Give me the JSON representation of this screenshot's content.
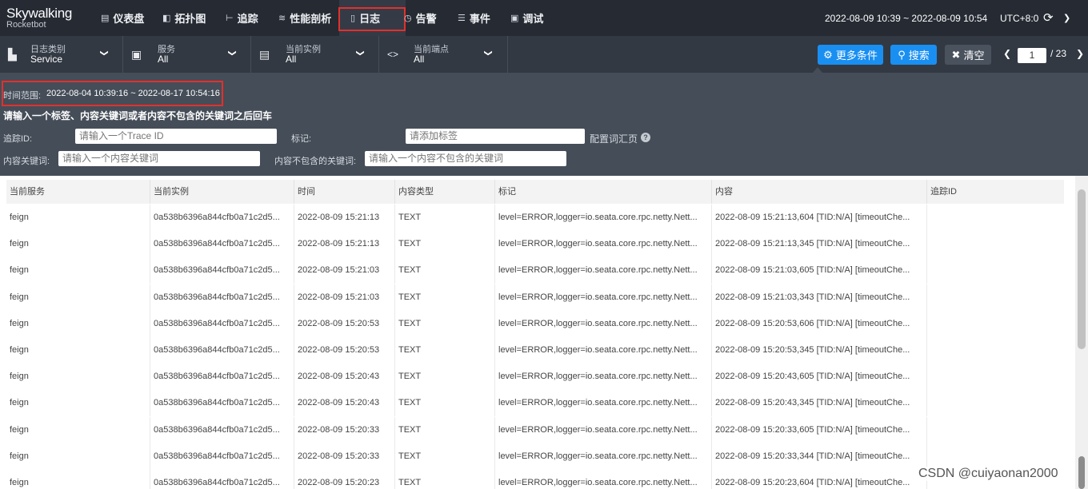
{
  "brand": {
    "name": "Skywalking",
    "sub": "Rocketbot"
  },
  "nav": [
    {
      "label": "仪表盘",
      "icon": "dashboard-icon"
    },
    {
      "label": "拓扑图",
      "icon": "topology-icon"
    },
    {
      "label": "追踪",
      "icon": "trace-icon"
    },
    {
      "label": "性能剖析",
      "icon": "profile-icon"
    },
    {
      "label": "日志",
      "icon": "log-icon"
    },
    {
      "label": "告警",
      "icon": "alarm-icon"
    },
    {
      "label": "事件",
      "icon": "event-icon"
    },
    {
      "label": "调试",
      "icon": "debug-icon"
    }
  ],
  "header": {
    "time_range": "2022-08-09 10:39 ~ 2022-08-09 10:54",
    "timezone": "UTC+8:0"
  },
  "filters": [
    {
      "label": "日志类别",
      "value": "Service"
    },
    {
      "label": "服务",
      "value": "All"
    },
    {
      "label": "当前实例",
      "value": "All"
    },
    {
      "label": "当前端点",
      "value": "All"
    }
  ],
  "actions": {
    "more": "更多条件",
    "search": "搜索",
    "clear": "清空"
  },
  "pagination": {
    "current": "1",
    "total": "/ 23"
  },
  "panel": {
    "time_label": "时间范围:",
    "time_value": "2022-08-04 10:39:16 ~ 2022-08-17 10:54:16",
    "hint": "请输入一个标签、内容关键词或者内容不包含的关键词之后回车",
    "trace_label": "追踪ID:",
    "trace_placeholder": "请输入一个Trace ID",
    "tag_label": "标记:",
    "tag_placeholder": "请添加标签",
    "vocab_label": "配置词汇页",
    "keyword_label": "内容关键词:",
    "keyword_placeholder": "请输入一个内容关键词",
    "exclude_label": "内容不包含的关键词:",
    "exclude_placeholder": "请输入一个内容不包含的关键词"
  },
  "table": {
    "columns": [
      "当前服务",
      "当前实例",
      "时间",
      "内容类型",
      "标记",
      "内容",
      "追踪ID"
    ],
    "rows": [
      [
        "feign",
        "0a538b6396a844cfb0a71c2d5...",
        "2022-08-09 15:21:13",
        "TEXT",
        "level=ERROR,logger=io.seata.core.rpc.netty.Nett...",
        "2022-08-09 15:21:13,604 [TID:N/A] [timeoutChe...",
        ""
      ],
      [
        "feign",
        "0a538b6396a844cfb0a71c2d5...",
        "2022-08-09 15:21:13",
        "TEXT",
        "level=ERROR,logger=io.seata.core.rpc.netty.Nett...",
        "2022-08-09 15:21:13,345 [TID:N/A] [timeoutChe...",
        ""
      ],
      [
        "feign",
        "0a538b6396a844cfb0a71c2d5...",
        "2022-08-09 15:21:03",
        "TEXT",
        "level=ERROR,logger=io.seata.core.rpc.netty.Nett...",
        "2022-08-09 15:21:03,605 [TID:N/A] [timeoutChe...",
        ""
      ],
      [
        "feign",
        "0a538b6396a844cfb0a71c2d5...",
        "2022-08-09 15:21:03",
        "TEXT",
        "level=ERROR,logger=io.seata.core.rpc.netty.Nett...",
        "2022-08-09 15:21:03,343 [TID:N/A] [timeoutChe...",
        ""
      ],
      [
        "feign",
        "0a538b6396a844cfb0a71c2d5...",
        "2022-08-09 15:20:53",
        "TEXT",
        "level=ERROR,logger=io.seata.core.rpc.netty.Nett...",
        "2022-08-09 15:20:53,606 [TID:N/A] [timeoutChe...",
        ""
      ],
      [
        "feign",
        "0a538b6396a844cfb0a71c2d5...",
        "2022-08-09 15:20:53",
        "TEXT",
        "level=ERROR,logger=io.seata.core.rpc.netty.Nett...",
        "2022-08-09 15:20:53,345 [TID:N/A] [timeoutChe...",
        ""
      ],
      [
        "feign",
        "0a538b6396a844cfb0a71c2d5...",
        "2022-08-09 15:20:43",
        "TEXT",
        "level=ERROR,logger=io.seata.core.rpc.netty.Nett...",
        "2022-08-09 15:20:43,605 [TID:N/A] [timeoutChe...",
        ""
      ],
      [
        "feign",
        "0a538b6396a844cfb0a71c2d5...",
        "2022-08-09 15:20:43",
        "TEXT",
        "level=ERROR,logger=io.seata.core.rpc.netty.Nett...",
        "2022-08-09 15:20:43,345 [TID:N/A] [timeoutChe...",
        ""
      ],
      [
        "feign",
        "0a538b6396a844cfb0a71c2d5...",
        "2022-08-09 15:20:33",
        "TEXT",
        "level=ERROR,logger=io.seata.core.rpc.netty.Nett...",
        "2022-08-09 15:20:33,605 [TID:N/A] [timeoutChe...",
        ""
      ],
      [
        "feign",
        "0a538b6396a844cfb0a71c2d5...",
        "2022-08-09 15:20:33",
        "TEXT",
        "level=ERROR,logger=io.seata.core.rpc.netty.Nett...",
        "2022-08-09 15:20:33,344 [TID:N/A] [timeoutChe...",
        ""
      ],
      [
        "feign",
        "0a538b6396a844cfb0a71c2d5...",
        "2022-08-09 15:20:23",
        "TEXT",
        "level=ERROR,logger=io.seata.core.rpc.netty.Nett...",
        "2022-08-09 15:20:23,604 [TID:N/A] [timeoutChe...",
        ""
      ]
    ]
  },
  "watermark": "CSDN @cuiyaonan2000",
  "colors": {
    "topbar": "#252a33",
    "filterbar": "#323943",
    "panel": "#454d58",
    "accent": "#1a8ff2",
    "highlight": "#e3302c"
  }
}
